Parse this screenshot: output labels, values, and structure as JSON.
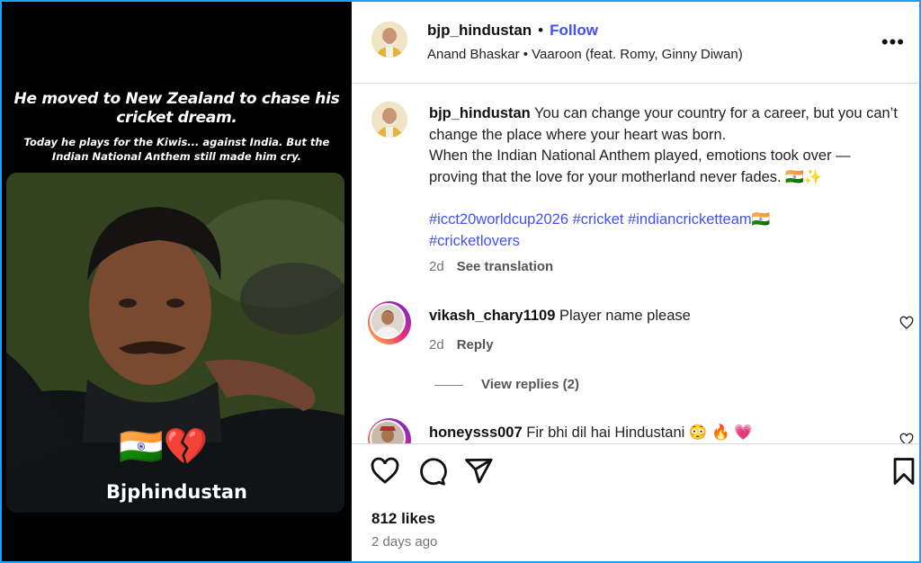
{
  "media": {
    "headline": "He moved to New Zealand to chase his cricket dream.",
    "subline": "Today he plays for the Kiwis... against India. But the Indian National Anthem still made him cry.",
    "emojis": "🇮🇳💔",
    "watermark": "Bjphindustan"
  },
  "header": {
    "username": "bjp_hindustan",
    "separator": "•",
    "follow_label": "Follow",
    "audio": "Anand Bhaskar • Vaaroon (feat. Romy, Ginny Diwan)",
    "more_label": "•••"
  },
  "caption": {
    "username": "bjp_hindustan",
    "text_line1": " You can change your country for a career, but you can’t change the place where your heart was born.",
    "text_line2": "When the Indian National Anthem played, emotions took over — proving that the love for your motherland never fades. 🇮🇳✨",
    "hashtags": [
      "#icct20worldcup2026",
      "#cricket",
      "#indiancricketteam🇮🇳",
      "#cricketlovers"
    ],
    "age": "2d",
    "translate_label": "See translation"
  },
  "comments": [
    {
      "username": "vikash_chary1109",
      "text": " Player name please",
      "age": "2d",
      "reply_label": "Reply"
    },
    {
      "username": "honeysss007",
      "text": " Fir bhi dil hai Hindustani 😳 🔥 💗"
    }
  ],
  "view_replies_label": "View replies (2)",
  "likes": "812 likes",
  "posted": "2 days ago",
  "icons": [
    "heart-icon",
    "comment-icon",
    "share-icon",
    "bookmark-icon"
  ],
  "colors": {
    "link": "#4150f7",
    "frame": "#1da1f2",
    "muted": "#737373"
  }
}
